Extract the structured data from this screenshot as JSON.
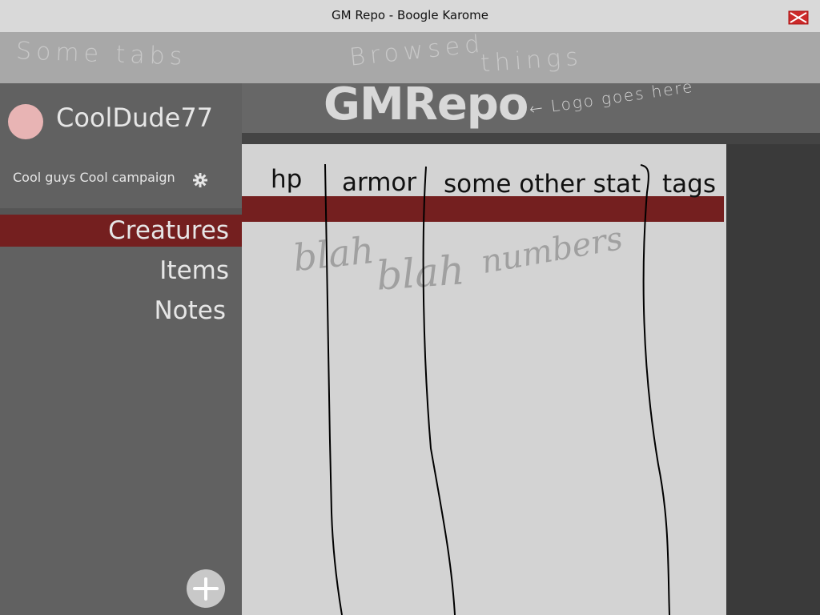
{
  "window": {
    "title": "GM Repo - Boogle Karome"
  },
  "tabstrip": {
    "note_tabs": "Some tabs",
    "note_browsed": "Browsed",
    "note_things": "things"
  },
  "sidebar": {
    "username": "CoolDude77",
    "campaign": "Cool guys Cool campaign",
    "nav": [
      {
        "label": "Creatures",
        "active": true
      },
      {
        "label": "Items",
        "active": false
      },
      {
        "label": "Notes",
        "active": false
      }
    ]
  },
  "header": {
    "logo": "GMRepo",
    "logo_note": "← Logo goes here"
  },
  "table": {
    "columns": [
      "hp",
      "armor",
      "some other stat",
      "tags"
    ],
    "placeholder_1": "blah",
    "placeholder_2": "blah",
    "placeholder_3": "numbers"
  },
  "colors": {
    "accent": "#741f1f",
    "avatar": "#e8b4b4",
    "sidebar": "#616161",
    "panel": "#d3d3d3"
  },
  "icons": {
    "close": "close-icon",
    "gear": "gear-icon",
    "add": "plus-icon"
  }
}
